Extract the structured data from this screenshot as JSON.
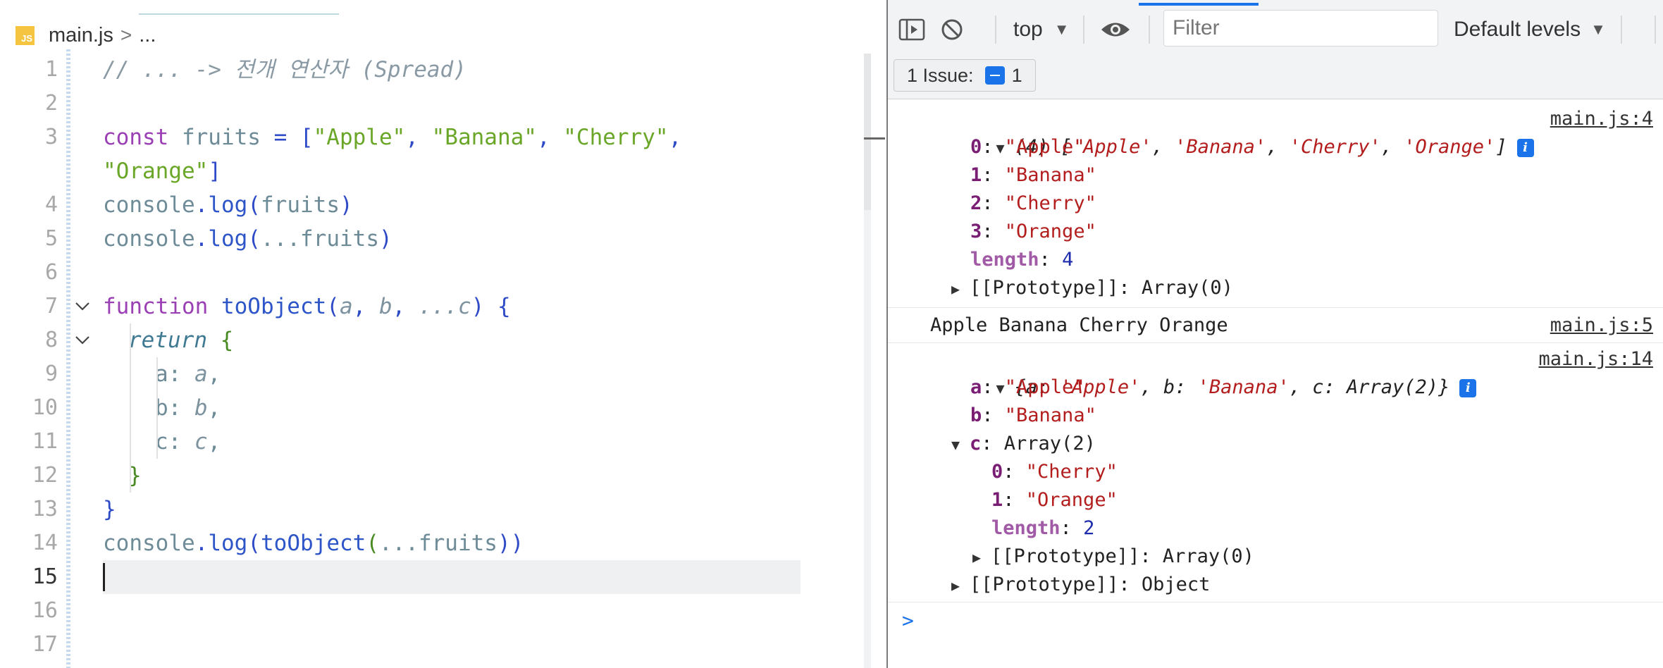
{
  "editor": {
    "breadcrumb": {
      "icon_text": "JS",
      "file": "main.js",
      "separator": ">",
      "more": "..."
    },
    "lines": [
      {
        "n": "1"
      },
      {
        "n": "2"
      },
      {
        "n": "3"
      },
      {
        "n": ""
      },
      {
        "n": "4"
      },
      {
        "n": "5"
      },
      {
        "n": "6"
      },
      {
        "n": "7"
      },
      {
        "n": "8"
      },
      {
        "n": "9"
      },
      {
        "n": "10"
      },
      {
        "n": "11"
      },
      {
        "n": "12"
      },
      {
        "n": "13"
      },
      {
        "n": "14"
      },
      {
        "n": "15"
      },
      {
        "n": "16"
      },
      {
        "n": "17"
      }
    ],
    "code": {
      "l1": "// ... -> 전개 연산자 (Spread)",
      "l3_const": "const ",
      "l3_name": "fruits ",
      "l3_eq": "= [",
      "l3_s1": "\"Apple\"",
      "l3_c1": ", ",
      "l3_s2": "\"Banana\"",
      "l3_c2": ", ",
      "l3_s3": "\"Cherry\"",
      "l3_c3": ",",
      "l3b_s4": "\"Orange\"",
      "l3b_close": "]",
      "l4_obj": "console",
      "l4_dot": ".",
      "l4_fn": "log",
      "l4_open": "(",
      "l4_arg": "fruits",
      "l4_close": ")",
      "l5_obj": "console",
      "l5_dot": ".",
      "l5_fn": "log",
      "l5_open": "(",
      "l5_spread": "...",
      "l5_arg": "fruits",
      "l5_close": ")",
      "l7_kw": "function ",
      "l7_fn": "toObject",
      "l7_open": "(",
      "l7_a": "a",
      "l7_c1": ", ",
      "l7_b": "b",
      "l7_c2": ", ",
      "l7_spread": "...",
      "l7_c": "c",
      "l7_close": ") {",
      "l8_ret": "return ",
      "l8_brace": "{",
      "l9_key": "a: ",
      "l9_val": "a",
      "l9_comma": ",",
      "l10_key": "b: ",
      "l10_val": "b",
      "l10_comma": ",",
      "l11_key": "c: ",
      "l11_val": "c",
      "l11_comma": ",",
      "l12": "}",
      "l13": "}",
      "l14_obj": "console",
      "l14_dot": ".",
      "l14_fn": "log",
      "l14_open": "(",
      "l14_fn2": "toObject",
      "l14_open2": "(",
      "l14_spread": "...",
      "l14_arg": "fruits",
      "l14_close": "))"
    }
  },
  "devtools": {
    "context": "top",
    "filter_placeholder": "Filter",
    "levels": "Default levels",
    "issues": {
      "label": "1 Issue:",
      "count": "1"
    },
    "messages": {
      "m1": {
        "summary_prefix": "(4) [",
        "items": [
          "'Apple'",
          "'Banana'",
          "'Cherry'",
          "'Orange'"
        ],
        "summary_suffix": "]",
        "source": "main.js:4",
        "entries": [
          {
            "k": "0",
            "v": "\"Apple\""
          },
          {
            "k": "1",
            "v": "\"Banana\""
          },
          {
            "k": "2",
            "v": "\"Cherry\""
          },
          {
            "k": "3",
            "v": "\"Orange\""
          }
        ],
        "length_key": "length",
        "length_val": "4",
        "proto": "[[Prototype]]: Array(0)"
      },
      "m2": {
        "text": "Apple Banana Cherry Orange",
        "source": "main.js:5"
      },
      "m3": {
        "summary_open": "{a: ",
        "a_val": "'Apple'",
        "mid1": ", b: ",
        "b_val": "'Banana'",
        "mid2": ", c: Array(2)}",
        "source": "main.js:14",
        "a_key": "a",
        "a": "\"Apple\"",
        "b_key": "b",
        "b": "\"Banana\"",
        "c_key": "c",
        "c_summary": "Array(2)",
        "c_entries": [
          {
            "k": "0",
            "v": "\"Cherry\""
          },
          {
            "k": "1",
            "v": "\"Orange\""
          }
        ],
        "c_length_key": "length",
        "c_length_val": "2",
        "c_proto": "[[Prototype]]: Array(0)",
        "proto": "[[Prototype]]: Object"
      }
    },
    "prompt": ">",
    "colors": {
      "accent": "#1a73e8",
      "string": "#b31d1d",
      "number": "#1d2bac",
      "key": "#7a1e74"
    }
  }
}
